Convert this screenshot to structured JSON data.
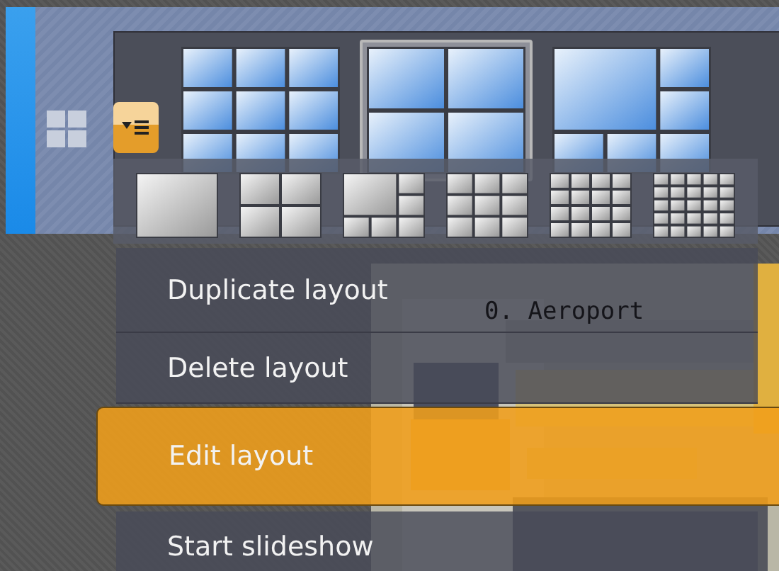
{
  "layout_panel": {
    "layouts": [
      {
        "kind": "nine",
        "selected": false
      },
      {
        "kind": "four",
        "selected": true
      },
      {
        "kind": "six",
        "selected": false
      }
    ],
    "presets": [
      {
        "kind": "one"
      },
      {
        "kind": "four"
      },
      {
        "kind": "six"
      },
      {
        "kind": "nine"
      },
      {
        "kind": "sixteen"
      },
      {
        "kind": "twentyfive"
      }
    ]
  },
  "camera_window": {
    "title": "0. Aeroport"
  },
  "menu": {
    "items": [
      {
        "label": "Duplicate layout",
        "selected": false
      },
      {
        "label": "Delete layout",
        "selected": false
      },
      {
        "label": "Edit layout",
        "selected": true
      },
      {
        "label": "Start slideshow",
        "selected": false
      }
    ]
  }
}
